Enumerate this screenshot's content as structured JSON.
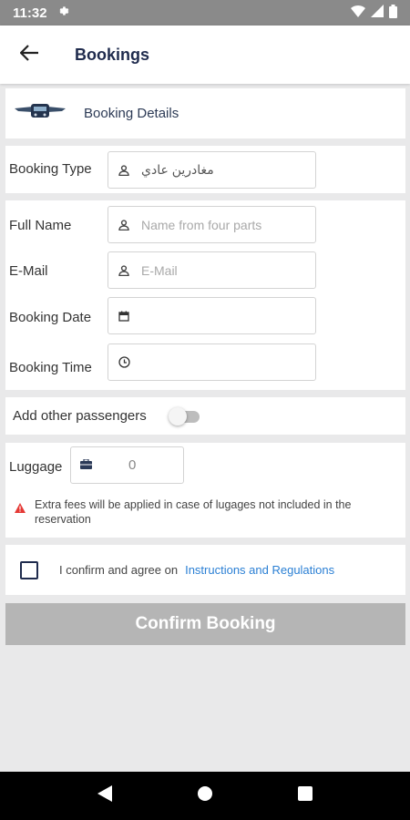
{
  "status_bar": {
    "time": "11:32"
  },
  "header": {
    "title": "Bookings"
  },
  "details": {
    "label": "Booking Details"
  },
  "booking_type": {
    "label": "Booking Type",
    "value": "مغادرين عادي"
  },
  "full_name": {
    "label": "Full Name",
    "placeholder": "Name from four parts"
  },
  "email": {
    "label": "E-Mail",
    "placeholder": "E-Mail"
  },
  "booking_date": {
    "label": "Booking Date",
    "value": ""
  },
  "booking_time": {
    "label": "Booking Time",
    "value": ""
  },
  "passengers": {
    "label": "Add other passengers",
    "enabled": false
  },
  "luggage": {
    "label": "Luggage",
    "value": "0",
    "warning": "Extra fees will be applied in case of lugages not included in the reservation"
  },
  "agreement": {
    "text": "I confirm and agree on",
    "link": "Instructions and Regulations",
    "checked": false
  },
  "confirm": {
    "label": "Confirm Booking"
  },
  "colors": {
    "primary": "#1f2b4d",
    "link": "#2a7fd4",
    "warning": "#e53935",
    "disabled_button": "#b5b5b5"
  },
  "icons": [
    "settings-icon",
    "wifi-icon",
    "signal-icon",
    "battery-icon",
    "back-arrow-icon",
    "bus-logo-icon",
    "person-icon",
    "calendar-icon",
    "clock-icon",
    "luggage-icon",
    "warning-icon",
    "nav-back-icon",
    "nav-home-icon",
    "nav-recents-icon"
  ]
}
